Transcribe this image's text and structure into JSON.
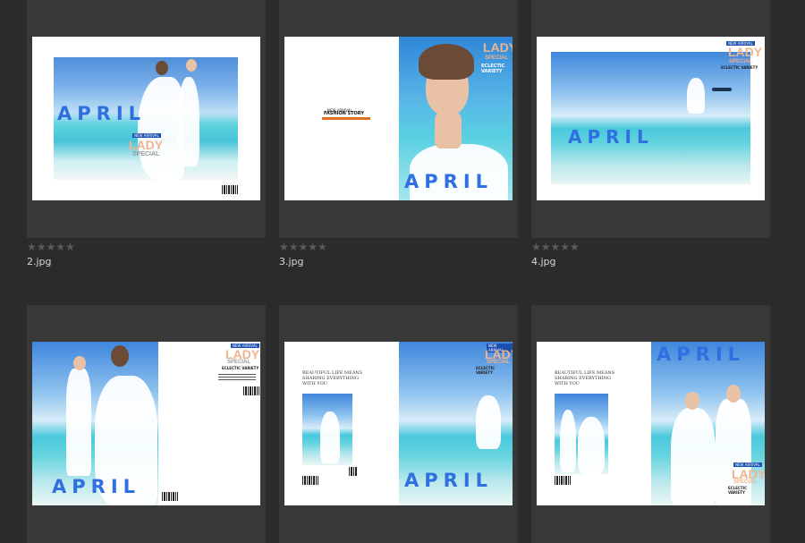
{
  "grid": {
    "items": [
      {
        "filename": "2.jpg",
        "rating_stars": "★★★★★",
        "rating": 0,
        "cover": {
          "main": "APRIL",
          "sub": "LADY",
          "sub2": "SPECIAL",
          "tag": "NEW ARRIVAL"
        }
      },
      {
        "filename": "3.jpg",
        "rating_stars": "★★★★★",
        "rating": 0,
        "cover": {
          "main": "APRIL",
          "sub": "LADY",
          "sub2": "SPECIAL",
          "tag": "NEW ARRIVAL",
          "left_title": "FASHION STORY",
          "extra": "ECLECTIC VARIETY"
        }
      },
      {
        "filename": "4.jpg",
        "rating_stars": "★★★★★",
        "rating": 0,
        "cover": {
          "main": "APRIL",
          "sub": "LADY",
          "sub2": "SPECIAL",
          "tag": "NEW ARRIVAL",
          "extra": "ECLECTIC VARIETY"
        }
      },
      {
        "filename": "",
        "rating_stars": "",
        "cover": {
          "main": "APRIL",
          "sub": "LADY",
          "sub2": "SPECIAL",
          "tag": "NEW ARRIVAL",
          "extra": "ECLECTIC VARIETY"
        }
      },
      {
        "filename": "",
        "rating_stars": "",
        "cover": {
          "main": "APRIL",
          "sub": "LADY",
          "sub2": "SPECIAL",
          "tag": "NEW ARRIVAL",
          "extra": "ECLECTIC VARIETY",
          "left_title": "BEAUTIFUL LIFE MEANS SHARING EVERYTHING WITH YOU"
        }
      },
      {
        "filename": "",
        "rating_stars": "",
        "cover": {
          "main": "APRIL",
          "sub": "LADY",
          "sub2": "SPECIAL",
          "tag": "NEW ARRIVAL",
          "extra": "ECLECTIC VARIETY",
          "left_title": "BEAUTIFUL LIFE MEANS SHARING EVERYTHING WITH YOU"
        }
      }
    ]
  }
}
